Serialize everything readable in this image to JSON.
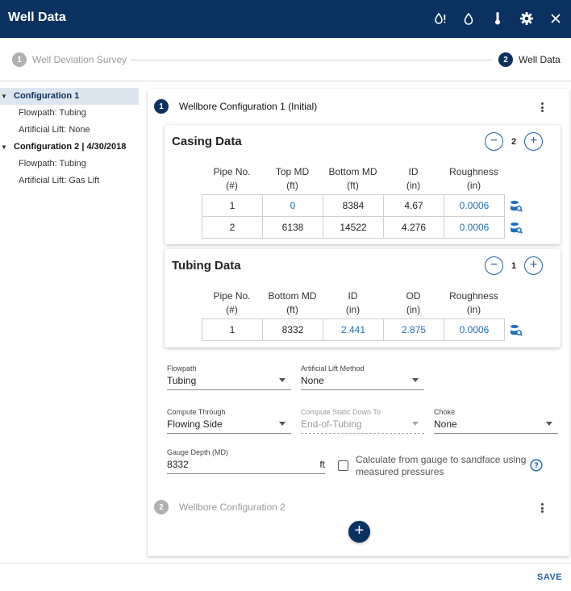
{
  "window": {
    "title": "Well Data",
    "icons": [
      "water-alert-icon",
      "water-drop-icon",
      "thermometer-icon",
      "gear-icon",
      "close-icon"
    ]
  },
  "stepper": {
    "steps": [
      {
        "num": "1",
        "label": "Well Deviation Survey"
      },
      {
        "num": "2",
        "label": "Well Data"
      }
    ]
  },
  "sidebar": {
    "items": [
      {
        "label": "Configuration 1"
      },
      {
        "label": "Flowpath: Tubing"
      },
      {
        "label": "Artificial Lift: None"
      },
      {
        "label": "Configuration 2 | 4/30/2018"
      },
      {
        "label": "Flowpath: Tubing"
      },
      {
        "label": "Artificial Lift: Gas Lift"
      }
    ]
  },
  "config1": {
    "num": "1",
    "title": "Wellbore Configuration 1 (Initial)"
  },
  "config2": {
    "num": "2",
    "title": "Wellbore Configuration 2"
  },
  "casing": {
    "title": "Casing Data",
    "count": "2",
    "headers": [
      {
        "name": "Pipe No.",
        "unit": "(#)"
      },
      {
        "name": "Top MD",
        "unit": "(ft)"
      },
      {
        "name": "Bottom MD",
        "unit": "(ft)"
      },
      {
        "name": "ID",
        "unit": "(in)"
      },
      {
        "name": "Roughness",
        "unit": "(in)"
      }
    ],
    "rows": [
      [
        "1",
        "0",
        "8384",
        "4.67",
        "0.0006"
      ],
      [
        "2",
        "6138",
        "14522",
        "4.276",
        "0.0006"
      ]
    ]
  },
  "tubing": {
    "title": "Tubing Data",
    "count": "1",
    "headers": [
      {
        "name": "Pipe No.",
        "unit": "(#)"
      },
      {
        "name": "Bottom MD",
        "unit": "(ft)"
      },
      {
        "name": "ID",
        "unit": "(in)"
      },
      {
        "name": "OD",
        "unit": "(in)"
      },
      {
        "name": "Roughness",
        "unit": "(in)"
      }
    ],
    "rows": [
      [
        "1",
        "8332",
        "2.441",
        "2.875",
        "0.0006"
      ]
    ]
  },
  "form": {
    "flowpath": {
      "label": "Flowpath",
      "value": "Tubing"
    },
    "artificial_lift": {
      "label": "Artificial Lift Method",
      "value": "None"
    },
    "compute_through": {
      "label": "Compute Through",
      "value": "Flowing Side"
    },
    "compute_static": {
      "label": "Compute Static Down To",
      "value": "End-of-Tubing"
    },
    "choke": {
      "label": "Choke",
      "value": "None"
    },
    "gauge_depth": {
      "label": "Gauge Depth (MD)",
      "value": "8332",
      "unit": "ft"
    },
    "calc_checkbox": {
      "label": "Calculate from gauge to sandface using measured pressures",
      "checked": false
    }
  },
  "footer": {
    "save_label": "SAVE"
  },
  "colors": {
    "navy": "#0b3160",
    "link_blue": "#1f6fb8",
    "selected_bg": "#dde5ee"
  }
}
